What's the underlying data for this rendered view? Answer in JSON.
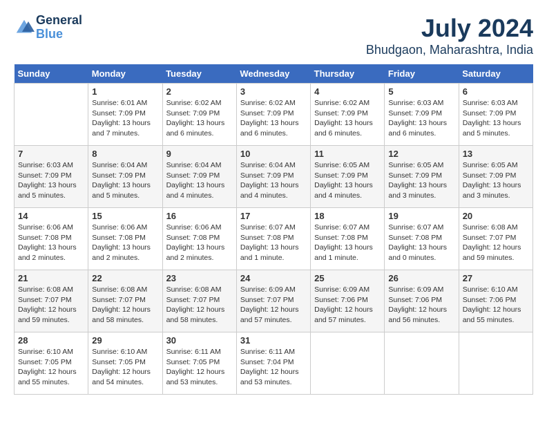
{
  "header": {
    "logo_line1": "General",
    "logo_line2": "Blue",
    "title": "July 2024",
    "subtitle": "Bhudgaon, Maharashtra, India"
  },
  "calendar": {
    "days_of_week": [
      "Sunday",
      "Monday",
      "Tuesday",
      "Wednesday",
      "Thursday",
      "Friday",
      "Saturday"
    ],
    "weeks": [
      [
        {
          "day": "",
          "sunrise": "",
          "sunset": "",
          "daylight": ""
        },
        {
          "day": "1",
          "sunrise": "6:01 AM",
          "sunset": "7:09 PM",
          "daylight": "13 hours and 7 minutes."
        },
        {
          "day": "2",
          "sunrise": "6:02 AM",
          "sunset": "7:09 PM",
          "daylight": "13 hours and 6 minutes."
        },
        {
          "day": "3",
          "sunrise": "6:02 AM",
          "sunset": "7:09 PM",
          "daylight": "13 hours and 6 minutes."
        },
        {
          "day": "4",
          "sunrise": "6:02 AM",
          "sunset": "7:09 PM",
          "daylight": "13 hours and 6 minutes."
        },
        {
          "day": "5",
          "sunrise": "6:03 AM",
          "sunset": "7:09 PM",
          "daylight": "13 hours and 6 minutes."
        },
        {
          "day": "6",
          "sunrise": "6:03 AM",
          "sunset": "7:09 PM",
          "daylight": "13 hours and 5 minutes."
        }
      ],
      [
        {
          "day": "7",
          "sunrise": "6:03 AM",
          "sunset": "7:09 PM",
          "daylight": "13 hours and 5 minutes."
        },
        {
          "day": "8",
          "sunrise": "6:04 AM",
          "sunset": "7:09 PM",
          "daylight": "13 hours and 5 minutes."
        },
        {
          "day": "9",
          "sunrise": "6:04 AM",
          "sunset": "7:09 PM",
          "daylight": "13 hours and 4 minutes."
        },
        {
          "day": "10",
          "sunrise": "6:04 AM",
          "sunset": "7:09 PM",
          "daylight": "13 hours and 4 minutes."
        },
        {
          "day": "11",
          "sunrise": "6:05 AM",
          "sunset": "7:09 PM",
          "daylight": "13 hours and 4 minutes."
        },
        {
          "day": "12",
          "sunrise": "6:05 AM",
          "sunset": "7:09 PM",
          "daylight": "13 hours and 3 minutes."
        },
        {
          "day": "13",
          "sunrise": "6:05 AM",
          "sunset": "7:09 PM",
          "daylight": "13 hours and 3 minutes."
        }
      ],
      [
        {
          "day": "14",
          "sunrise": "6:06 AM",
          "sunset": "7:08 PM",
          "daylight": "13 hours and 2 minutes."
        },
        {
          "day": "15",
          "sunrise": "6:06 AM",
          "sunset": "7:08 PM",
          "daylight": "13 hours and 2 minutes."
        },
        {
          "day": "16",
          "sunrise": "6:06 AM",
          "sunset": "7:08 PM",
          "daylight": "13 hours and 2 minutes."
        },
        {
          "day": "17",
          "sunrise": "6:07 AM",
          "sunset": "7:08 PM",
          "daylight": "13 hours and 1 minute."
        },
        {
          "day": "18",
          "sunrise": "6:07 AM",
          "sunset": "7:08 PM",
          "daylight": "13 hours and 1 minute."
        },
        {
          "day": "19",
          "sunrise": "6:07 AM",
          "sunset": "7:08 PM",
          "daylight": "13 hours and 0 minutes."
        },
        {
          "day": "20",
          "sunrise": "6:08 AM",
          "sunset": "7:07 PM",
          "daylight": "12 hours and 59 minutes."
        }
      ],
      [
        {
          "day": "21",
          "sunrise": "6:08 AM",
          "sunset": "7:07 PM",
          "daylight": "12 hours and 59 minutes."
        },
        {
          "day": "22",
          "sunrise": "6:08 AM",
          "sunset": "7:07 PM",
          "daylight": "12 hours and 58 minutes."
        },
        {
          "day": "23",
          "sunrise": "6:08 AM",
          "sunset": "7:07 PM",
          "daylight": "12 hours and 58 minutes."
        },
        {
          "day": "24",
          "sunrise": "6:09 AM",
          "sunset": "7:07 PM",
          "daylight": "12 hours and 57 minutes."
        },
        {
          "day": "25",
          "sunrise": "6:09 AM",
          "sunset": "7:06 PM",
          "daylight": "12 hours and 57 minutes."
        },
        {
          "day": "26",
          "sunrise": "6:09 AM",
          "sunset": "7:06 PM",
          "daylight": "12 hours and 56 minutes."
        },
        {
          "day": "27",
          "sunrise": "6:10 AM",
          "sunset": "7:06 PM",
          "daylight": "12 hours and 55 minutes."
        }
      ],
      [
        {
          "day": "28",
          "sunrise": "6:10 AM",
          "sunset": "7:05 PM",
          "daylight": "12 hours and 55 minutes."
        },
        {
          "day": "29",
          "sunrise": "6:10 AM",
          "sunset": "7:05 PM",
          "daylight": "12 hours and 54 minutes."
        },
        {
          "day": "30",
          "sunrise": "6:11 AM",
          "sunset": "7:05 PM",
          "daylight": "12 hours and 53 minutes."
        },
        {
          "day": "31",
          "sunrise": "6:11 AM",
          "sunset": "7:04 PM",
          "daylight": "12 hours and 53 minutes."
        },
        {
          "day": "",
          "sunrise": "",
          "sunset": "",
          "daylight": ""
        },
        {
          "day": "",
          "sunrise": "",
          "sunset": "",
          "daylight": ""
        },
        {
          "day": "",
          "sunrise": "",
          "sunset": "",
          "daylight": ""
        }
      ]
    ]
  }
}
